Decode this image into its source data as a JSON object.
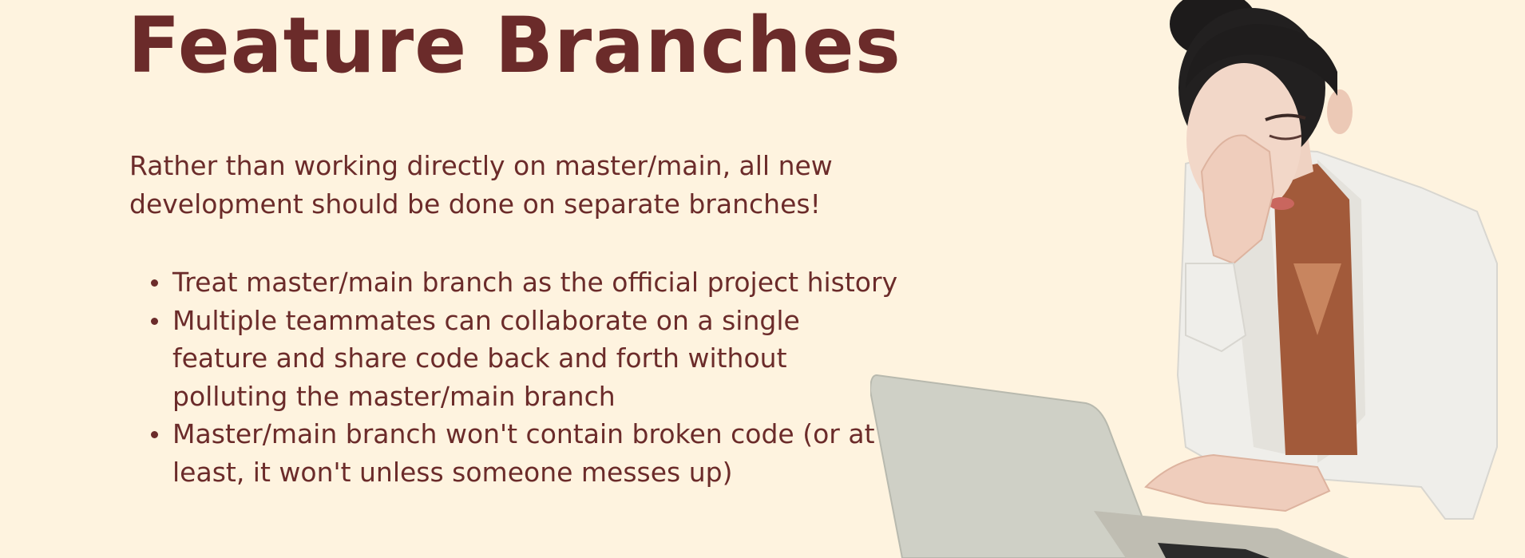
{
  "slide": {
    "title": "Feature Branches",
    "intro_lines": [
      "Rather than working directly on master/main, all new",
      "development should be done on separate branches!"
    ],
    "bullets": [
      {
        "lines": [
          "Treat master/main branch as the official project history"
        ]
      },
      {
        "lines": [
          "Multiple teammates can collaborate on a single",
          "feature and share code back and forth without",
          "polluting the master/main branch"
        ]
      },
      {
        "lines": [
          "Master/main branch won't contain broken code (or at",
          "least, it won't unless someone messes up)"
        ]
      }
    ]
  },
  "image": {
    "subject": "frustrated woman at laptop"
  },
  "colors": {
    "background": "#fef3df",
    "text": "#6b2b2a"
  }
}
